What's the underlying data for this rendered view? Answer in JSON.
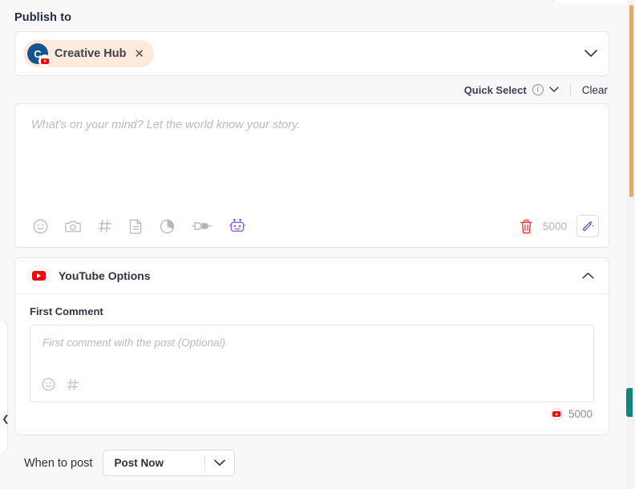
{
  "publish": {
    "title": "Publish to",
    "chip": {
      "avatar_initial": "C",
      "label": "Creative Hub",
      "remove": "✕",
      "platform_icon": "youtube-icon"
    },
    "caret": "∨"
  },
  "quick_select": {
    "label": "Quick Select",
    "info": "i",
    "caret": "∨",
    "clear": "Clear"
  },
  "composer": {
    "placeholder": "What's on your mind? Let the world know your story.",
    "char_count": "5000",
    "tools": [
      {
        "name": "emoji-icon",
        "glyph": "☺"
      },
      {
        "name": "camera-icon",
        "glyph": "□"
      },
      {
        "name": "hashtag-icon",
        "glyph": "#"
      },
      {
        "name": "document-icon",
        "glyph": "☰"
      },
      {
        "name": "pie-chart-icon",
        "glyph": "◔"
      },
      {
        "name": "plug-icon",
        "glyph": "⊸"
      },
      {
        "name": "ai-robot-icon",
        "glyph": "▢"
      }
    ],
    "trash": "delete-icon",
    "wand": "magic-wand-icon"
  },
  "youtube_options": {
    "title": "YouTube Options",
    "collapse_caret": "∧",
    "first_comment": {
      "label": "First Comment",
      "placeholder": "First comment with the post (Optional)",
      "tools": [
        {
          "name": "emoji-icon",
          "glyph": "☺"
        },
        {
          "name": "hashtag-icon",
          "glyph": "#"
        }
      ],
      "char_count": "5000"
    }
  },
  "when_to_post": {
    "label": "When to post",
    "value": "Post Now",
    "caret": "∨"
  },
  "colors": {
    "accent_orange": "#f5a44f",
    "youtube_red": "#ff0000",
    "ai_purple": "#8b5cf6",
    "chip_bg": "#fdeada",
    "avatar_blue": "#15558f",
    "teal_tab": "#11857d"
  }
}
